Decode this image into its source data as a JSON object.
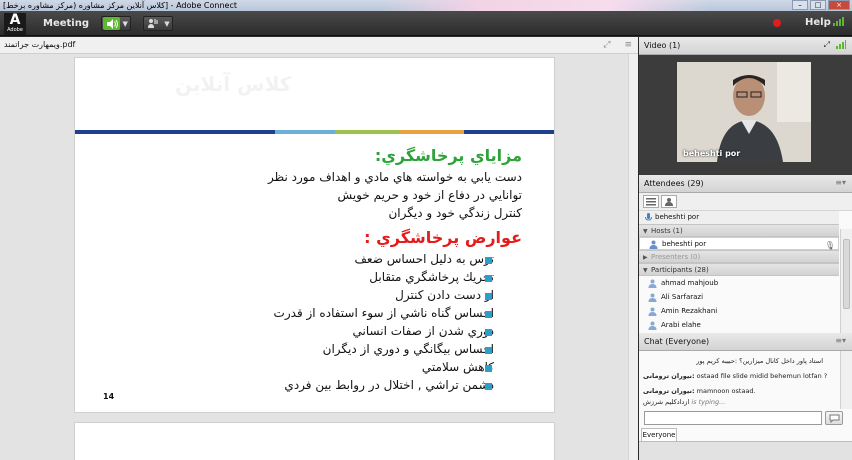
{
  "window": {
    "title": "[کلاس آنلاین مرکز مشاوره (مرکز مشاوره برخط] - Adobe Connect",
    "buttons": [
      "–",
      "□",
      "×"
    ]
  },
  "menubar": {
    "logo_letter": "A",
    "logo_word": "Adobe",
    "meeting_label": "Meeting",
    "help_label": "Help",
    "recording_color": "#e01e1e",
    "accent_green": "#5cb82e"
  },
  "share": {
    "filename": "ویمهارت جراتمند.pdf",
    "header_icons": [
      "fullscreen-icon",
      "options-icon"
    ]
  },
  "slide": {
    "watermark": "کلاس آنلاین",
    "title": "مزاياي پرخاشگري:",
    "lines": [
      "دست يابي به خواسته هاي مادي و اهداف مورد نظر",
      "توانايي در دفاع از خود و حريم خويش",
      "كنترل زندگي خود و ديگران"
    ],
    "title2": "عوارض پرخاشگري :",
    "bullets": [
      "ترس به دليل احساس ضعف",
      "تحريك  پرخاشگري متقابل",
      "از دست دادن كنترل",
      "احساس گناه ناشي از سوء استفاده از قدرت",
      "دوري شدن از صفات انساني",
      "احساس بيگانگي و دوري از ديگران",
      "كاهش سلامتي",
      "دشمن تراشي , اختلال در روابط بين فردي"
    ],
    "page_number": "14",
    "title_color": "#2ea33a",
    "title2_color": "#e31b1b",
    "bullet_color": "#2a9fc9",
    "bar_colors": [
      "#1f3f8f",
      "#1f3f8f",
      "#1f3f8f",
      "#6cb0d8",
      "#9ac24c",
      "#e8a33c",
      "#1f3f8f"
    ]
  },
  "video": {
    "title": "Video",
    "count": "(1)",
    "speaker": "beheshti por"
  },
  "attendees": {
    "title": "Attendees",
    "count": "(29)",
    "active_speaker": "beheshti por",
    "hosts_label": "Hosts (1)",
    "host": "beheshti por",
    "presenters_label": "Presenters (0)",
    "participants_label": "Participants (28)",
    "participants": [
      "ahmad mahjoub",
      "Ali Sarfarazi",
      "Amin Rezakhani",
      "Arabi elahe"
    ]
  },
  "chat": {
    "title": "Chat",
    "scope": "(Everyone)",
    "messages": [
      {
        "text": "استاد پاور داخل کانال میزارین؟ :حبیبه کریم پور",
        "rtl": true
      },
      {
        "who": "نیوران ترومانی:",
        "text": " ostaad  file  slide  midid  behemun  lotfan  ?",
        "rtl": false
      },
      {
        "who": "نیوران ترومانی:",
        "text": " mamnoon  ostaad.",
        "rtl": false
      }
    ],
    "typing": "is typing...",
    "typing_name": "ازدادکلیم شرزش",
    "input_placeholder": "",
    "tab_label": "Everyone"
  }
}
